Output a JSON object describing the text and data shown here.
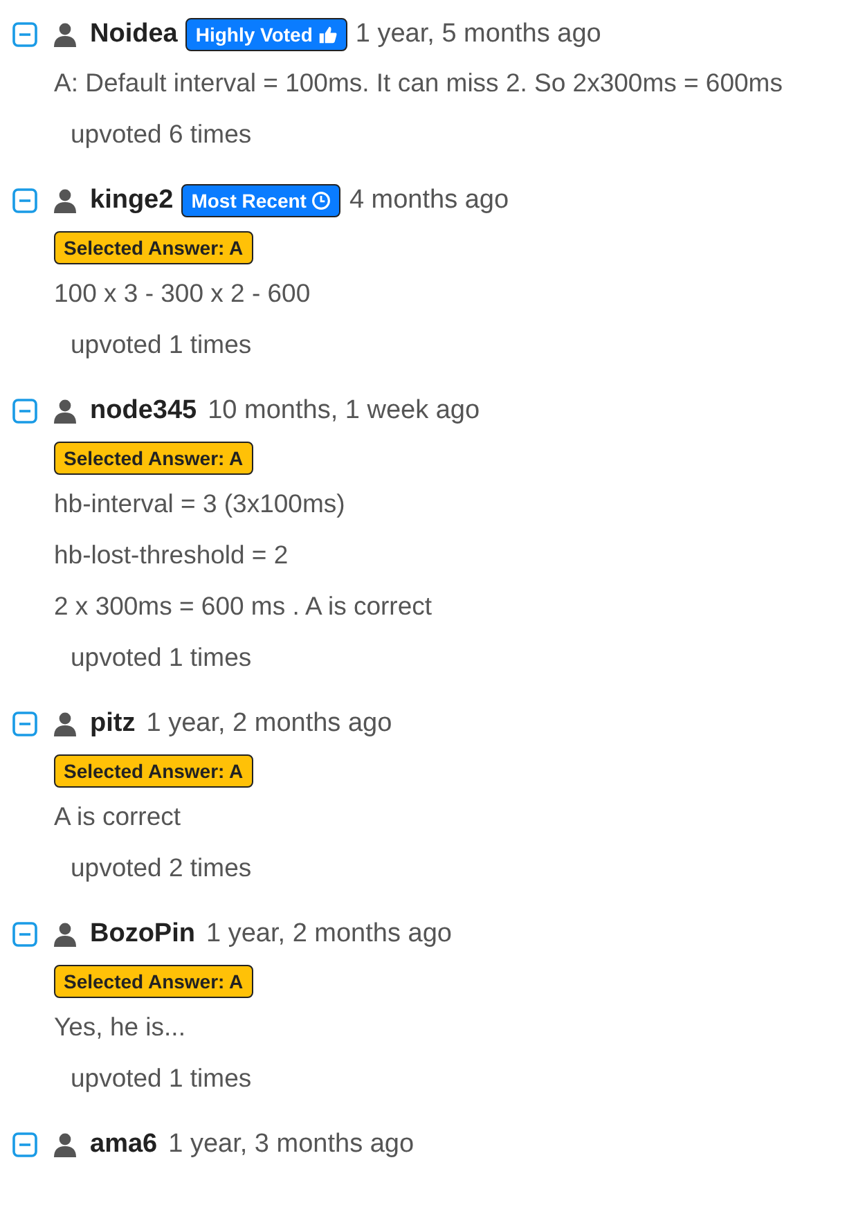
{
  "comments": [
    {
      "user": "Noidea",
      "badge": {
        "kind": "highly_voted",
        "label": "Highly Voted"
      },
      "time": "1 year, 5 months ago",
      "lines": [
        "A: Default interval = 100ms. It can miss 2. So 2x300ms = 600ms"
      ],
      "upvotes": "upvoted 6 times"
    },
    {
      "user": "kinge2",
      "badge": {
        "kind": "most_recent",
        "label": "Most Recent"
      },
      "time": "4 months ago",
      "selected_answer": "Selected Answer: A",
      "lines": [
        "100 x 3 - 300 x 2 - 600"
      ],
      "upvotes": "upvoted 1 times"
    },
    {
      "user": "node345",
      "time": "10 months, 1 week ago",
      "selected_answer": "Selected Answer: A",
      "lines": [
        "hb-interval = 3 (3x100ms)",
        "hb-lost-threshold = 2",
        "2 x 300ms = 600 ms . A is correct"
      ],
      "upvotes": "upvoted 1 times"
    },
    {
      "user": "pitz",
      "time": "1 year, 2 months ago",
      "selected_answer": "Selected Answer: A",
      "lines": [
        "A is correct"
      ],
      "upvotes": "upvoted 2 times"
    },
    {
      "user": "BozoPin",
      "time": "1 year, 2 months ago",
      "selected_answer": "Selected Answer: A",
      "lines": [
        "Yes, he is..."
      ],
      "upvotes": "upvoted 1 times"
    },
    {
      "user": "ama6",
      "time": "1 year, 3 months ago"
    }
  ]
}
